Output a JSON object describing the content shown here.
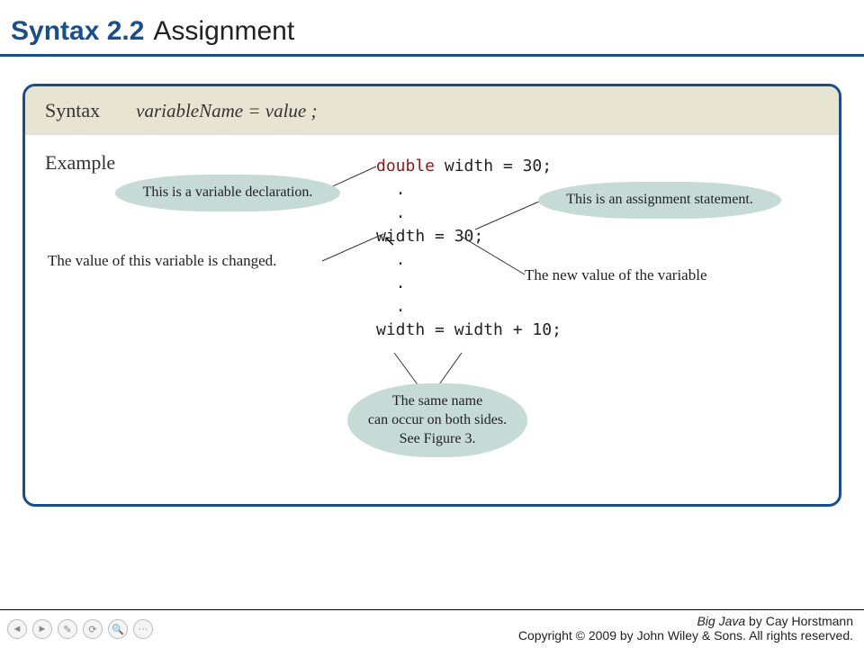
{
  "title": {
    "number": "Syntax 2.2",
    "text": "Assignment"
  },
  "syntax": {
    "label": "Syntax",
    "code": "variableName = value ;"
  },
  "example": {
    "label": "Example",
    "line1_kw": "double",
    "line1_rest": " width = 30;",
    "dots1": "  .\n  .",
    "line2": "width = 30;",
    "dots2": "  .\n  .\n  .",
    "line3": "width = width + 10;"
  },
  "callouts": {
    "decl": "This is a variable declaration.",
    "assign": "This is an assignment statement.",
    "changed": "The value of this variable is changed.",
    "newval": "The new value of the variable",
    "samename": "The same name\ncan occur on both sides.\nSee Figure 3."
  },
  "footer": {
    "book": "Big Java",
    "author": " by Cay Horstmann",
    "copyright": "Copyright © 2009 by John Wiley & Sons.  All rights reserved."
  },
  "nav": {
    "b1": "◄",
    "b2": "►",
    "b3": "✎",
    "b4": "⟳",
    "b5": "🔍",
    "b6": "···"
  }
}
